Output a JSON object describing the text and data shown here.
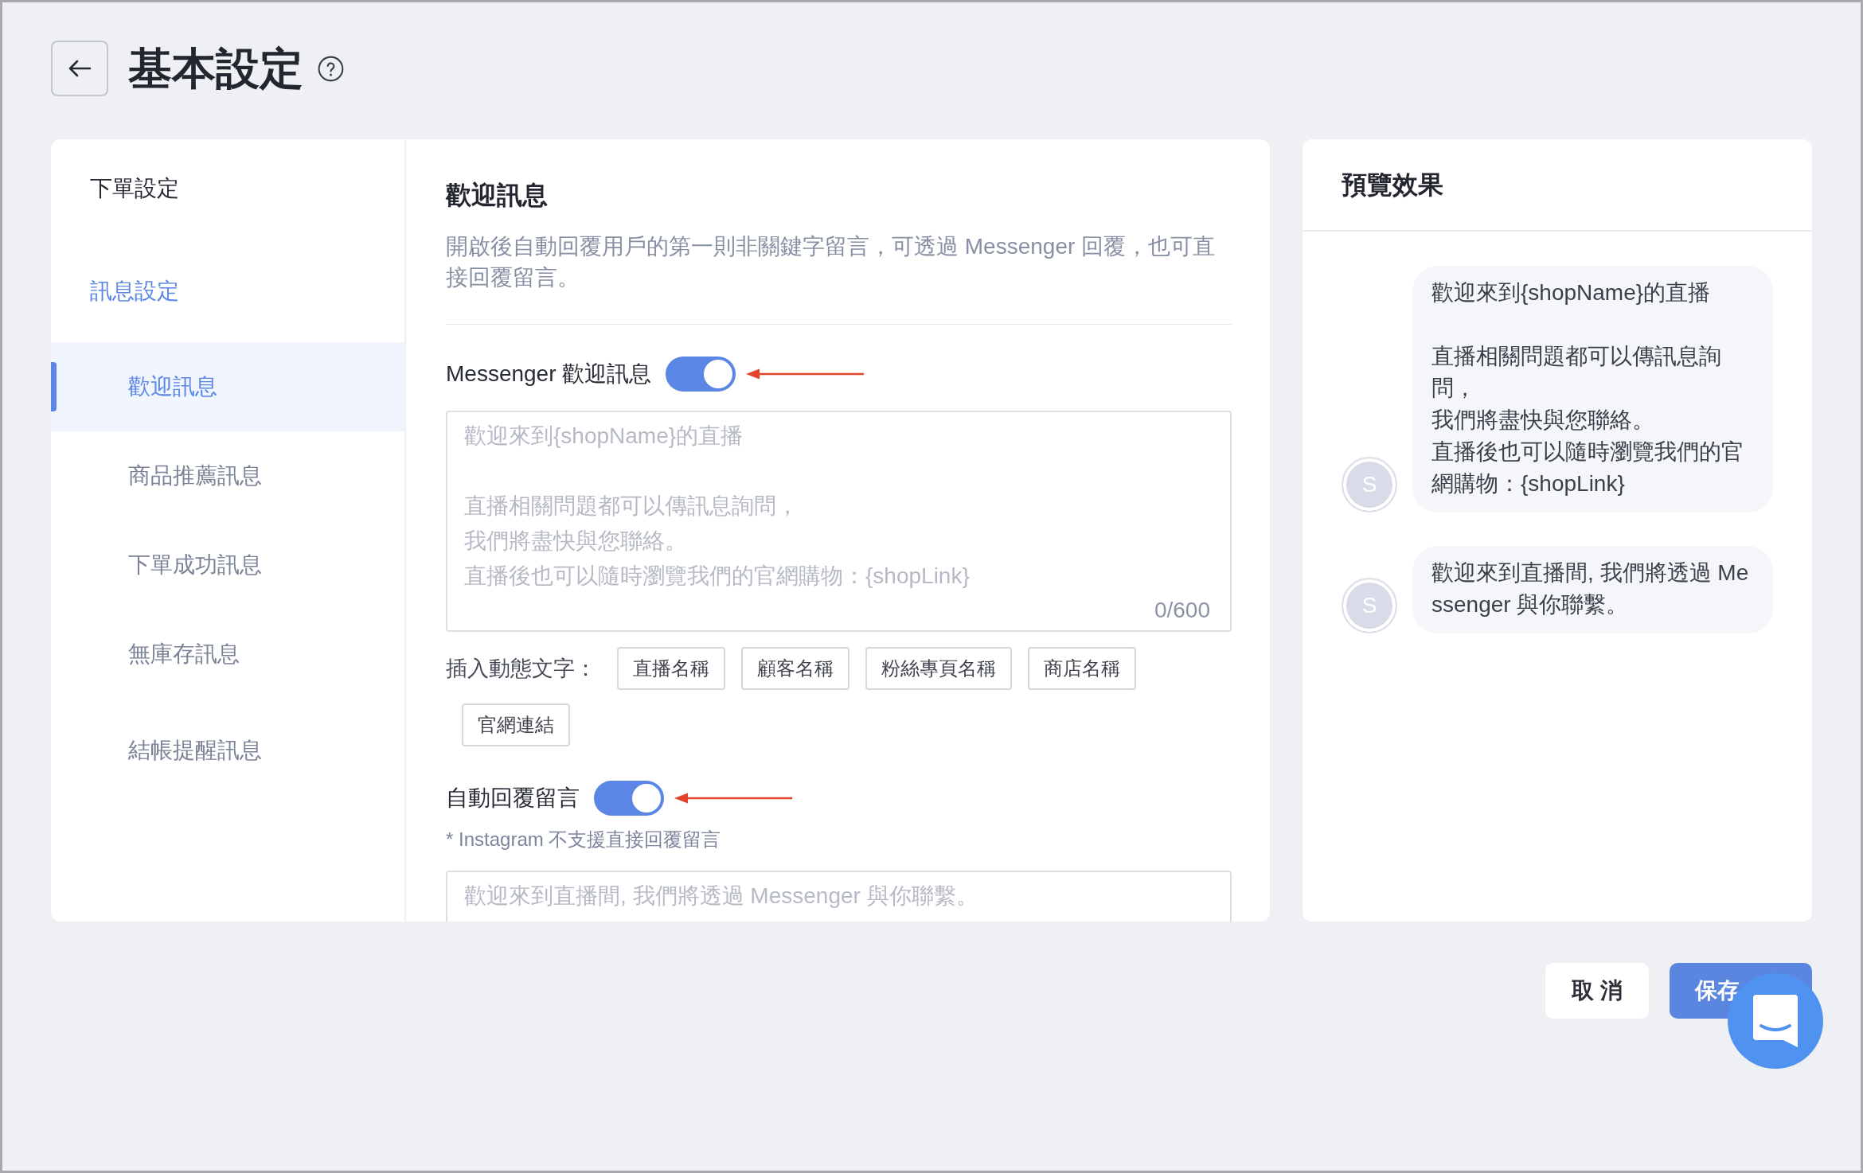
{
  "header": {
    "title": "基本設定"
  },
  "sidebar": {
    "groups": [
      {
        "label": "下單設定",
        "active": false
      },
      {
        "label": "訊息設定",
        "active": true,
        "items": [
          {
            "label": "歡迎訊息",
            "selected": true
          },
          {
            "label": "商品推薦訊息",
            "selected": false
          },
          {
            "label": "下單成功訊息",
            "selected": false
          },
          {
            "label": "無庫存訊息",
            "selected": false
          },
          {
            "label": "結帳提醒訊息",
            "selected": false
          }
        ]
      }
    ]
  },
  "section": {
    "title": "歡迎訊息",
    "description": "開啟後自動回覆用戶的第一則非關鍵字留言，可透過 Messenger 回覆，也可直接回覆留言。"
  },
  "messenger_welcome": {
    "label": "Messenger 歡迎訊息",
    "on": true,
    "annotated": true,
    "placeholder": [
      [
        "歡迎來到{shopName}的直播"
      ],
      [
        "直播相關問題都可以傳訊息詢問，",
        "我們將盡快與您聯絡。",
        "直播後也可以隨時瀏覽我們的官網購物：{shopLink}"
      ]
    ],
    "counter": "0/600"
  },
  "insert_variables": {
    "label": "插入動態文字：",
    "tags": [
      "直播名稱",
      "顧客名稱",
      "粉絲專頁名稱",
      "商店名稱",
      "官網連結"
    ]
  },
  "auto_reply": {
    "label": "自動回覆留言",
    "on": true,
    "annotated": true,
    "note": "* Instagram 不支援直接回覆留言",
    "placeholder": "歡迎來到直播間, 我們將透過 Messenger 與你聯繫。"
  },
  "preview": {
    "title": "預覽效果",
    "messages": [
      {
        "avatar": "S",
        "paragraphs": [
          [
            "歡迎來到{shopName}的直播"
          ],
          [
            "直播相關問題都可以傳訊息詢問，",
            "我們將盡快與您聯絡。",
            "直播後也可以隨時瀏覽我們的官網購物：{shopLink}"
          ]
        ]
      },
      {
        "avatar": "S",
        "paragraphs": [
          [
            "歡迎來到直播間, 我們將透過 Messenger 與你聯繫。"
          ]
        ]
      }
    ]
  },
  "footer": {
    "buttons": [
      {
        "label": "取 消",
        "kind": "secondary"
      },
      {
        "label": "保存",
        "kind": "primary"
      }
    ]
  }
}
